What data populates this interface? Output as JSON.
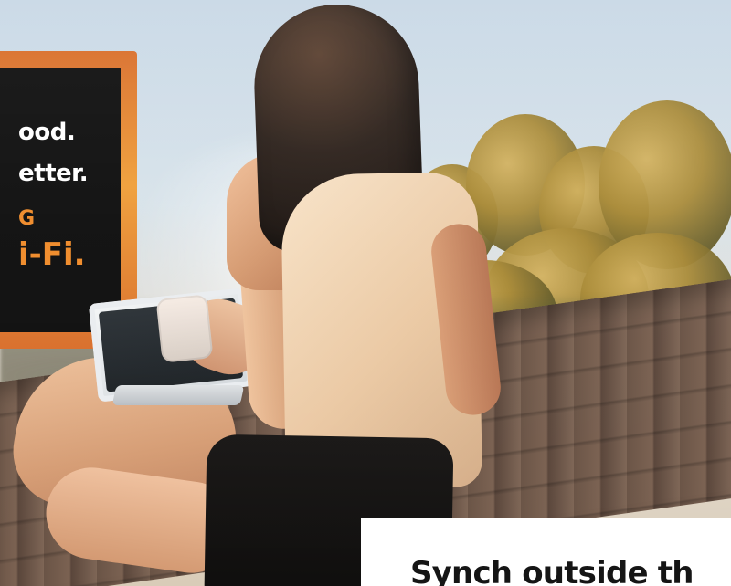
{
  "ad": {
    "line1": "ood.",
    "line2": "etter.",
    "accent_small": "G",
    "accent_large": "i-Fi."
  },
  "bottom_card": {
    "text": "Synch outside th"
  }
}
